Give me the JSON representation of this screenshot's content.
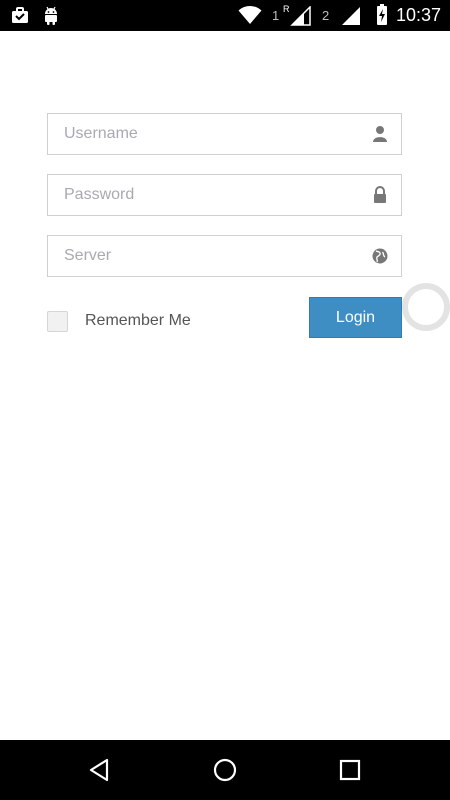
{
  "status_bar": {
    "time": "10:37",
    "sim1_label": "1",
    "sim1_roaming": "R",
    "sim2_label": "2",
    "icons": [
      "briefcase-icon",
      "android-icon",
      "wifi-icon",
      "signal-icon",
      "battery-charging-icon"
    ]
  },
  "login_form": {
    "username_placeholder": "Username",
    "password_placeholder": "Password",
    "server_placeholder": "Server",
    "username_icon": "user-icon",
    "password_icon": "lock-icon",
    "server_icon": "globe-icon",
    "remember_label": "Remember Me",
    "remember_checked": false,
    "login_label": "Login",
    "accent_color": "#3e8ec4"
  },
  "nav_bar": {
    "icons": [
      "back-icon",
      "home-icon",
      "recents-icon"
    ]
  }
}
